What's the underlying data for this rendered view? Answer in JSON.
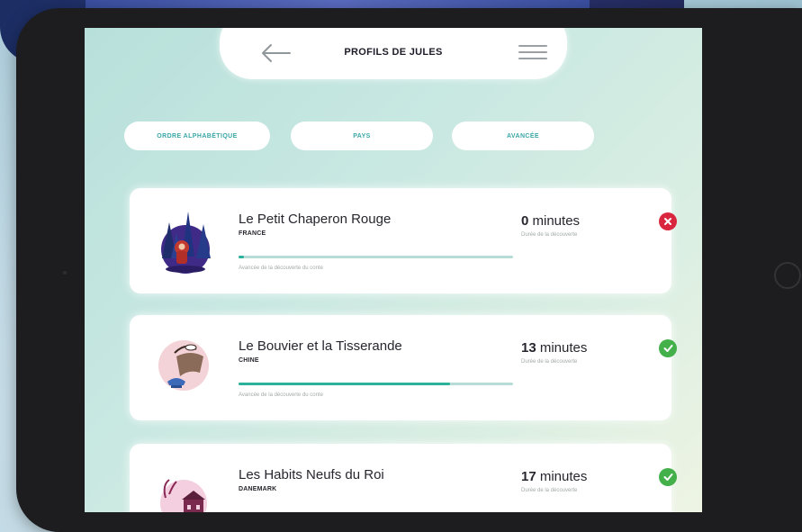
{
  "header": {
    "title": "PROFILS DE JULES",
    "back_icon": "arrow-left-icon",
    "menu_icon": "hamburger-menu-icon"
  },
  "filters": [
    {
      "label": "ORDRE ALPHABÉTIQUE"
    },
    {
      "label": "PAYS"
    },
    {
      "label": "AVANCÉE"
    }
  ],
  "stories": [
    {
      "title": "Le Petit Chaperon Rouge",
      "country": "FRANCE",
      "minutes_value": "0",
      "minutes_unit": "minutes",
      "duration_label": "Durée de la découverte",
      "progress_label": "Avancée de la découverte du conte",
      "progress": 0.02,
      "status": "incomplete",
      "status_icon": "close-circle-icon",
      "illustration": "forest-red-riding-hood-icon"
    },
    {
      "title": "Le Bouvier et la Tisserande",
      "country": "CHINE",
      "minutes_value": "13",
      "minutes_unit": "minutes",
      "duration_label": "Durée de la découverte",
      "progress_label": "Avancée de la découverte du conte",
      "progress": 0.77,
      "status": "complete",
      "status_icon": "check-circle-icon",
      "illustration": "bridge-magpie-icon"
    },
    {
      "title": "Les Habits Neufs du Roi",
      "country": "DANEMARK",
      "minutes_value": "17",
      "minutes_unit": "minutes",
      "duration_label": "Durée de la découverte",
      "status": "complete",
      "status_icon": "check-circle-icon",
      "illustration": "palace-tree-icon"
    }
  ],
  "colors": {
    "accent": "#2cb29c",
    "success": "#43b04a",
    "error": "#d9263e",
    "filter_text": "#3aa7a5"
  }
}
